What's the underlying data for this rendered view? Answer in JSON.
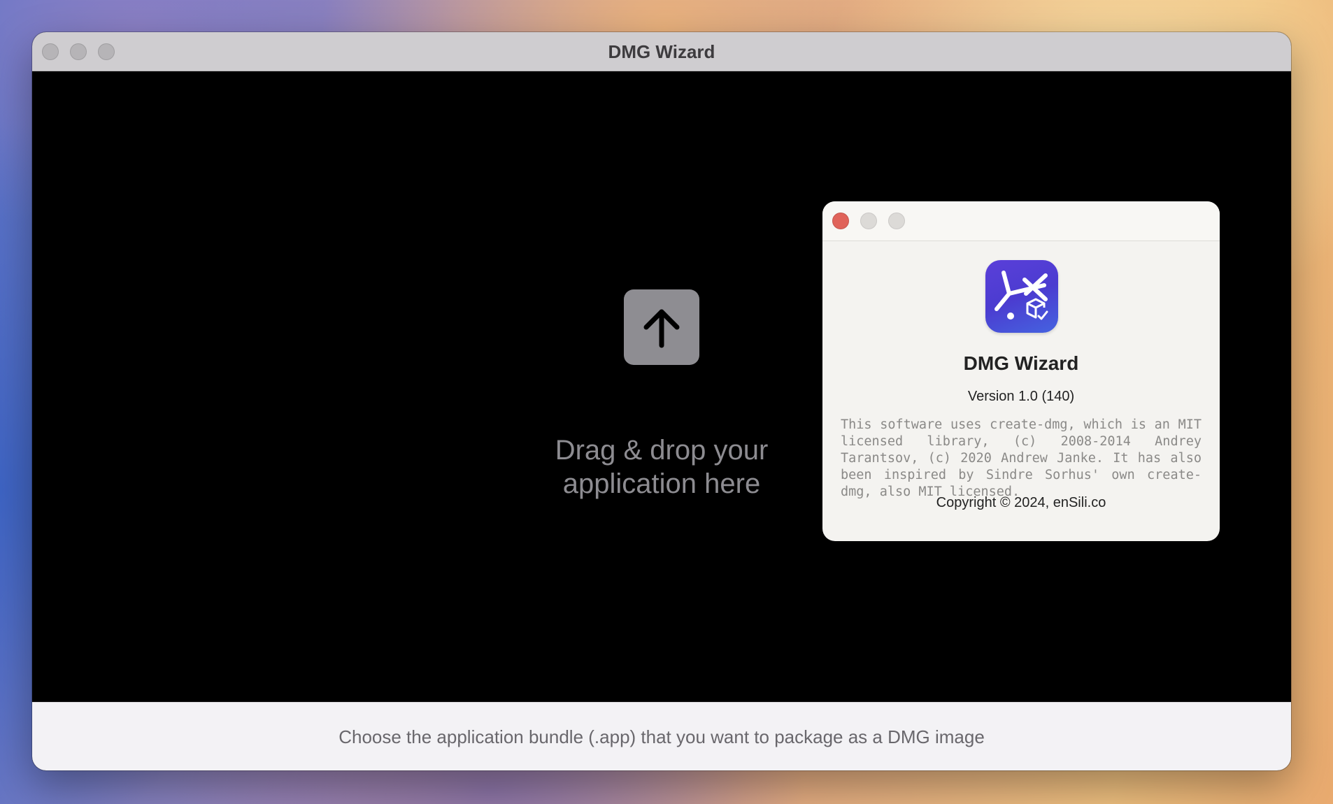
{
  "main_window": {
    "title": "DMG Wizard",
    "drop_zone": {
      "icon": "arrow-up-icon",
      "message": "Drag & drop your application here"
    },
    "footer": {
      "hint": "Choose the application bundle (.app) that you want to package as a DMG image"
    }
  },
  "about_dialog": {
    "icon": "dmg-wizard-app-icon",
    "app_name": "DMG Wizard",
    "version": "Version 1.0 (140)",
    "license": "This software uses create-dmg, which is an MIT licensed library, (c) 2008-2014 Andrey Tarantsov, (c) 2020 Andrew Janke. It has also been inspired by Sindre Sorhus' own create-dmg, also MIT licensed.",
    "copyright": "Copyright © 2024, enSili.co"
  },
  "colors": {
    "close_red": "#e0635a",
    "icon_purple": "#4b3cd0",
    "drop_background": "#000000"
  }
}
